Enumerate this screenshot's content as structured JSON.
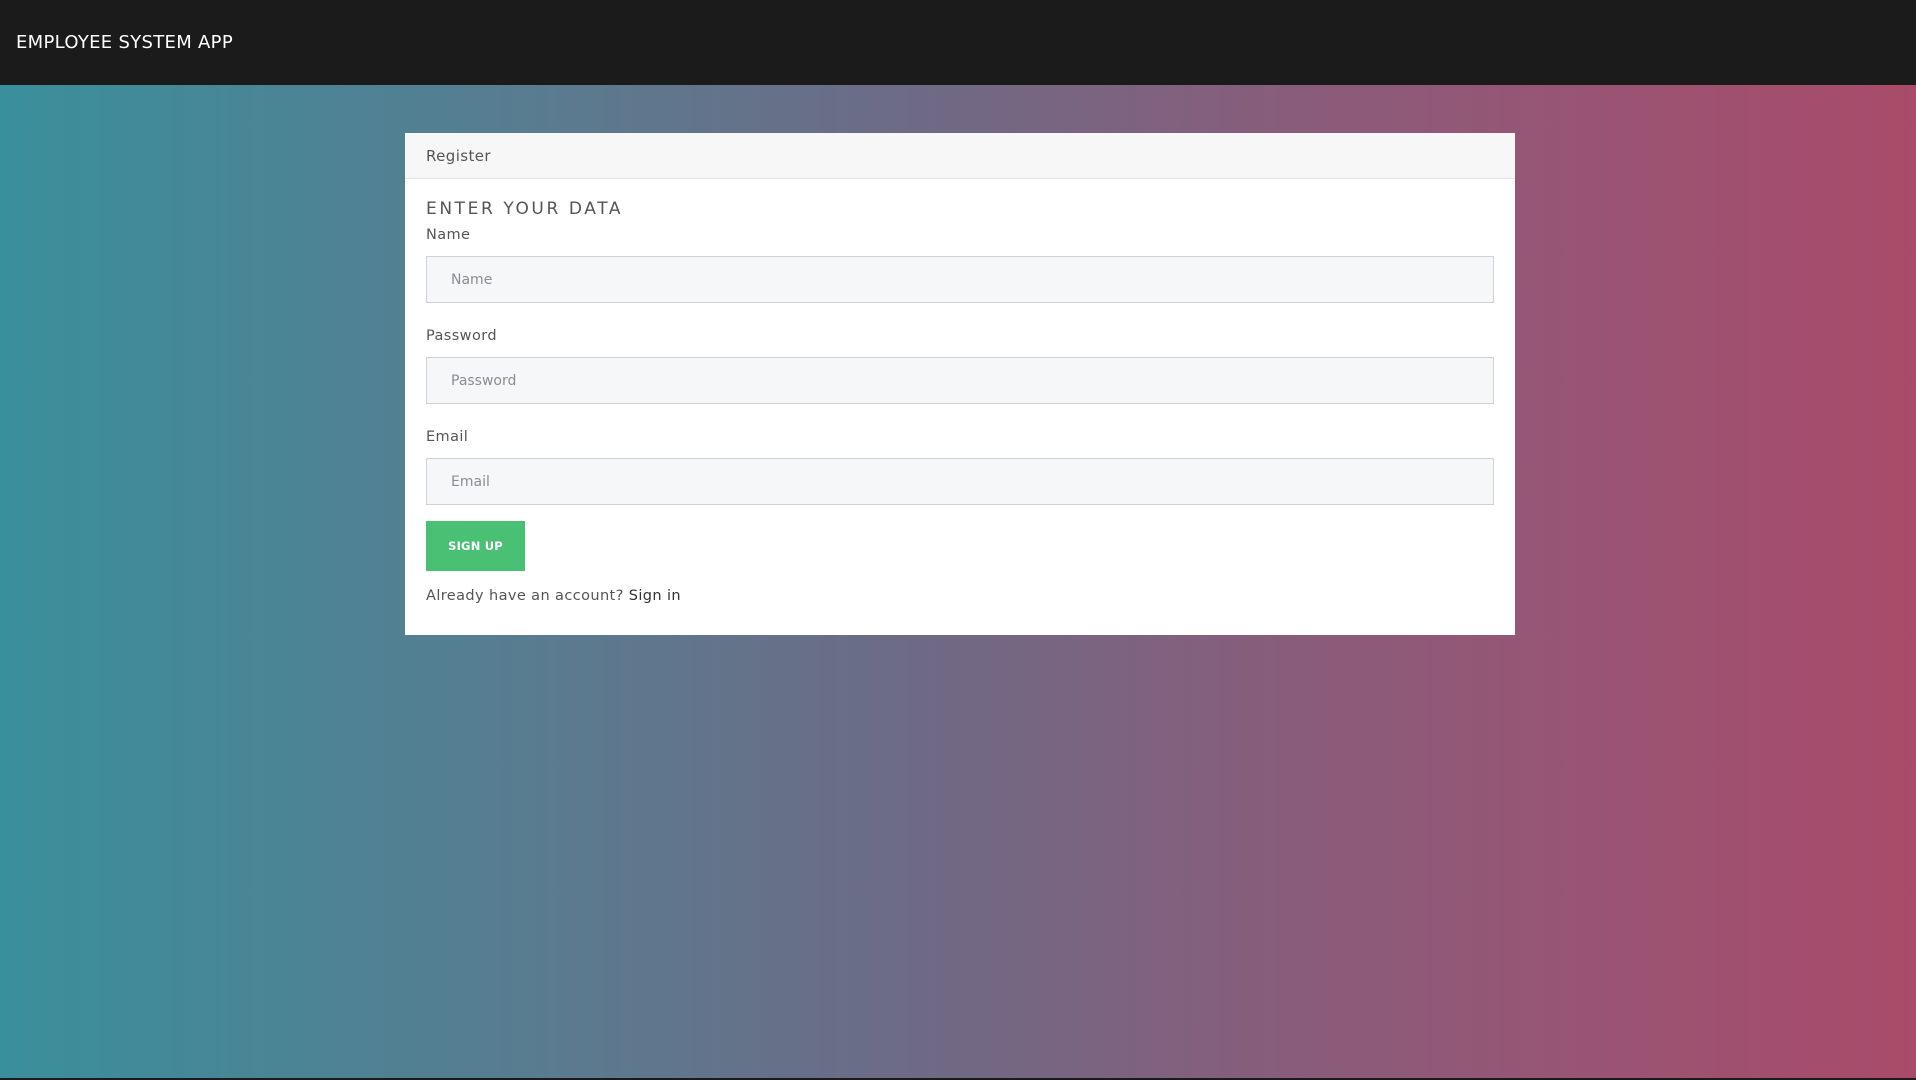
{
  "navbar": {
    "brand": "EMPLOYEE SYSTEM APP"
  },
  "card": {
    "header": "Register",
    "title": "ENTER YOUR DATA",
    "fields": {
      "name": {
        "label": "Name",
        "placeholder": "Name",
        "value": ""
      },
      "password": {
        "label": "Password",
        "placeholder": "Password",
        "value": ""
      },
      "email": {
        "label": "Email",
        "placeholder": "Email",
        "value": ""
      }
    },
    "submit_label": "SIGN UP",
    "footer_text": "Already have an account?",
    "signin_link": "Sign in"
  },
  "colors": {
    "navbar_bg": "#1b1b1b",
    "button_bg": "#49c073",
    "gradient_left": "#3a8f9c",
    "gradient_right": "#a94b6a"
  }
}
